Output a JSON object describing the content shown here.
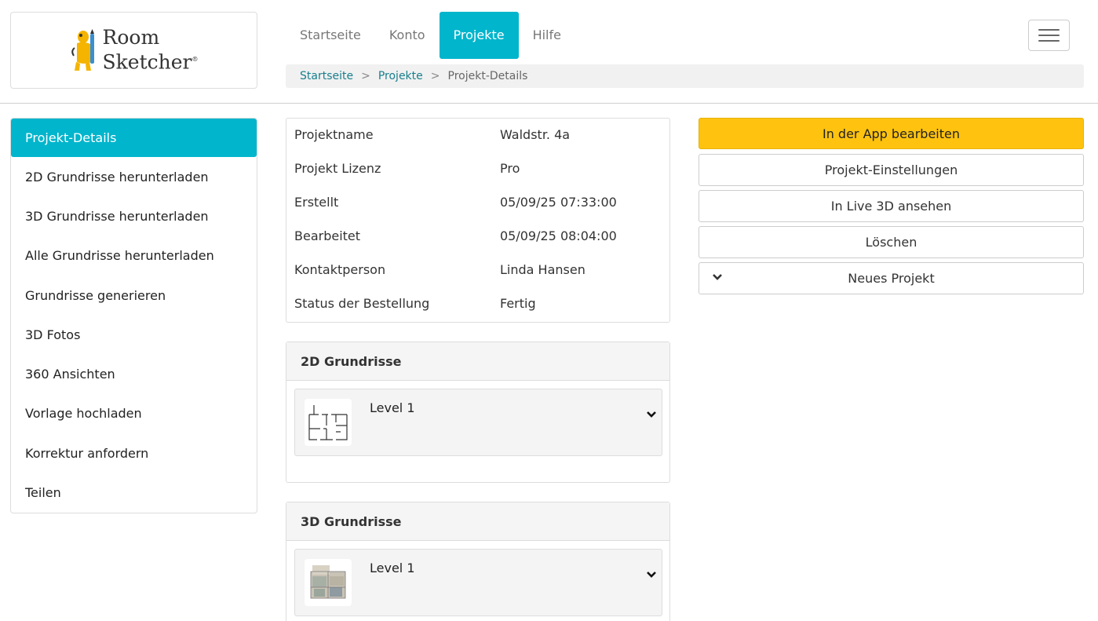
{
  "brand": {
    "logo_line1": "Room",
    "logo_line2": "Sketcher",
    "logo_mark": "®"
  },
  "nav": {
    "items": [
      {
        "label": "Startseite"
      },
      {
        "label": "Konto"
      },
      {
        "label": "Projekte",
        "active": true
      },
      {
        "label": "Hilfe"
      }
    ],
    "menu_icon": "hamburger-icon"
  },
  "breadcrumb": {
    "home": "Startseite",
    "projects": "Projekte",
    "current": "Projekt-Details",
    "separator": ">"
  },
  "sidebar": {
    "items": [
      {
        "label": "Projekt-Details",
        "active": true
      },
      {
        "label": "2D Grundrisse herunterladen"
      },
      {
        "label": "3D Grundrisse herunterladen"
      },
      {
        "label": "Alle Grundrisse herunterladen"
      },
      {
        "label": "Grundrisse generieren"
      },
      {
        "label": "3D Fotos"
      },
      {
        "label": "360 Ansichten"
      },
      {
        "label": "Vorlage hochladen"
      },
      {
        "label": "Korrektur anfordern"
      },
      {
        "label": "Teilen"
      }
    ]
  },
  "details": {
    "rows": [
      {
        "label": "Projektname",
        "value": "Waldstr. 4a"
      },
      {
        "label": "Projekt Lizenz",
        "value": "Pro"
      },
      {
        "label": "Erstellt",
        "value": "05/09/25 07:33:00"
      },
      {
        "label": "Bearbeitet",
        "value": "05/09/25 08:04:00"
      },
      {
        "label": "Kontaktperson",
        "value": "Linda Hansen"
      },
      {
        "label": "Status der Bestellung",
        "value": "Fertig"
      }
    ]
  },
  "panels": {
    "plans_2d": {
      "title": "2D Grundrisse",
      "level": "Level 1"
    },
    "plans_3d": {
      "title": "3D Grundrisse",
      "level": "Level 1"
    }
  },
  "actions": {
    "edit_in_app": "In der App bearbeiten",
    "project_settings": "Projekt-Einstellungen",
    "live_3d": "In Live 3D ansehen",
    "delete": "Löschen",
    "new_project": "Neues Projekt"
  },
  "colors": {
    "accent": "#00b5cc",
    "primary_button": "#ffc30f",
    "link": "#187f8c"
  }
}
